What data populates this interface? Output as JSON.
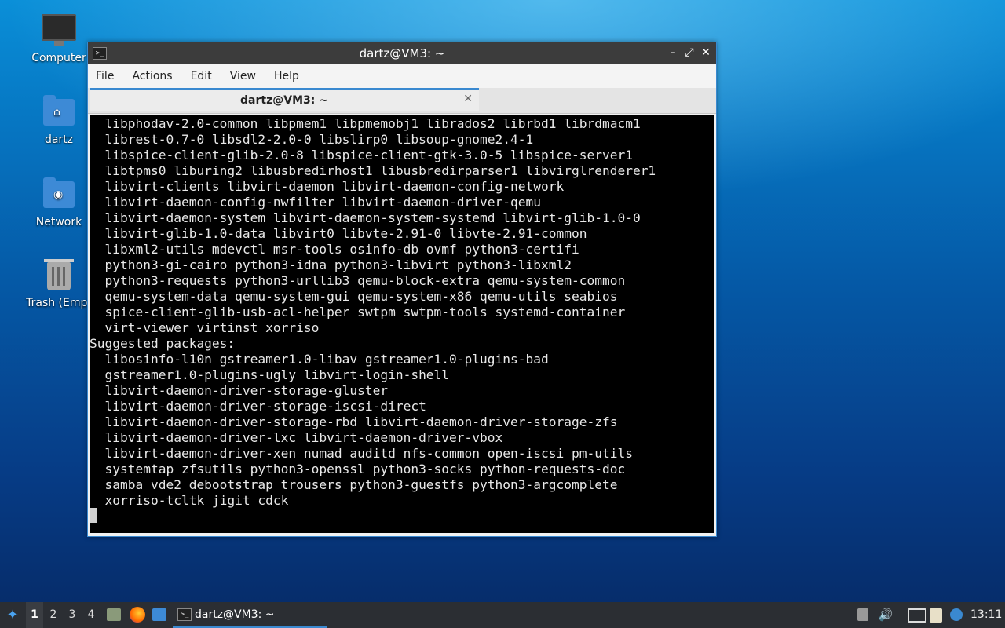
{
  "desktop": {
    "icons": [
      {
        "label": "Computer",
        "icon": "computer-icon"
      },
      {
        "label": "dartz",
        "icon": "home-folder-icon"
      },
      {
        "label": "Network",
        "icon": "network-folder-icon"
      },
      {
        "label": "Trash (Empt",
        "icon": "trash-icon"
      }
    ]
  },
  "window": {
    "title": "dartz@VM3: ~",
    "menu": [
      "File",
      "Actions",
      "Edit",
      "View",
      "Help"
    ],
    "tab_label": "dartz@VM3: ~",
    "terminal_lines": [
      "  libphodav-2.0-common libpmem1 libpmemobj1 librados2 librbd1 librdmacm1",
      "  librest-0.7-0 libsdl2-2.0-0 libslirp0 libsoup-gnome2.4-1",
      "  libspice-client-glib-2.0-8 libspice-client-gtk-3.0-5 libspice-server1",
      "  libtpms0 liburing2 libusbredirhost1 libusbredirparser1 libvirglrenderer1",
      "  libvirt-clients libvirt-daemon libvirt-daemon-config-network",
      "  libvirt-daemon-config-nwfilter libvirt-daemon-driver-qemu",
      "  libvirt-daemon-system libvirt-daemon-system-systemd libvirt-glib-1.0-0",
      "  libvirt-glib-1.0-data libvirt0 libvte-2.91-0 libvte-2.91-common",
      "  libxml2-utils mdevctl msr-tools osinfo-db ovmf python3-certifi",
      "  python3-gi-cairo python3-idna python3-libvirt python3-libxml2",
      "  python3-requests python3-urllib3 qemu-block-extra qemu-system-common",
      "  qemu-system-data qemu-system-gui qemu-system-x86 qemu-utils seabios",
      "  spice-client-glib-usb-acl-helper swtpm swtpm-tools systemd-container",
      "  virt-viewer virtinst xorriso",
      "Suggested packages:",
      "  libosinfo-l10n gstreamer1.0-libav gstreamer1.0-plugins-bad",
      "  gstreamer1.0-plugins-ugly libvirt-login-shell",
      "  libvirt-daemon-driver-storage-gluster",
      "  libvirt-daemon-driver-storage-iscsi-direct",
      "  libvirt-daemon-driver-storage-rbd libvirt-daemon-driver-storage-zfs",
      "  libvirt-daemon-driver-lxc libvirt-daemon-driver-vbox",
      "  libvirt-daemon-driver-xen numad auditd nfs-common open-iscsi pm-utils",
      "  systemtap zfsutils python3-openssl python3-socks python-requests-doc",
      "  samba vde2 debootstrap trousers python3-guestfs python3-argcomplete",
      "  xorriso-tcltk jigit cdck"
    ]
  },
  "taskbar": {
    "workspaces": [
      "1",
      "2",
      "3",
      "4"
    ],
    "active_workspace": "1",
    "task_label": "dartz@VM3: ~",
    "clock": "13:11"
  },
  "colors": {
    "accent": "#3a89d0",
    "titlebar": "#3c3c3c",
    "terminal_bg": "#000000",
    "taskbar": "#2b2e33"
  }
}
